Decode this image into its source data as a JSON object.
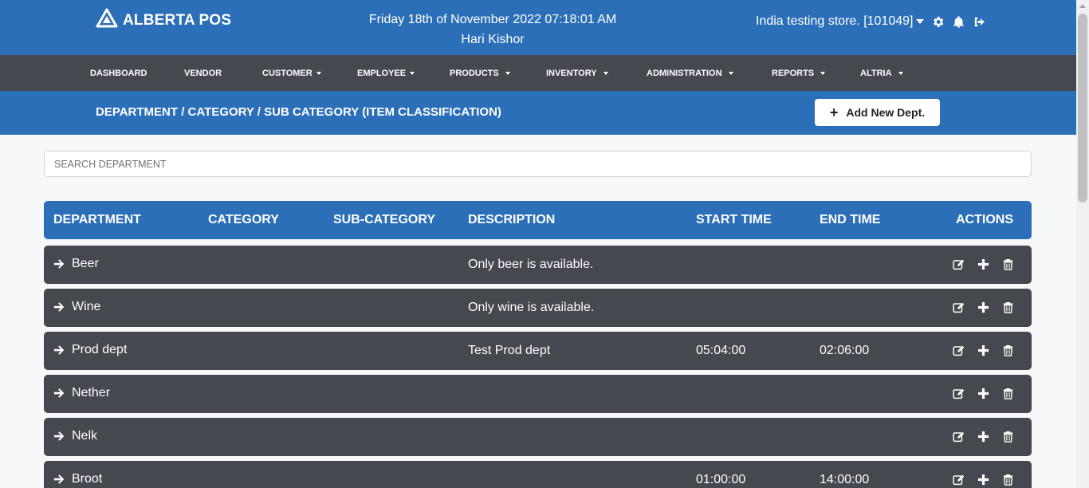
{
  "header": {
    "brand": "ALBERTA POS",
    "datetime": "Friday 18th of November 2022 07:18:01 AM",
    "user": "Hari Kishor",
    "store": "India testing store. [101049]",
    "icons": [
      "settings-gear-icon",
      "bell-icon",
      "logout-icon"
    ]
  },
  "nav": {
    "items": [
      {
        "label": "DASHBOARD"
      },
      {
        "label": "VENDOR"
      },
      {
        "label": "CUSTOMER"
      },
      {
        "label": "EMPLOYEE"
      },
      {
        "label": "PRODUCTS"
      },
      {
        "label": "INVENTORY"
      },
      {
        "label": "ADMINISTRATION"
      },
      {
        "label": "REPORTS"
      },
      {
        "label": "ALTRIA"
      }
    ]
  },
  "subheader": {
    "title": "DEPARTMENT / CATEGORY / SUB CATEGORY (ITEM CLASSIFICATION)",
    "add_button": "Add New Dept."
  },
  "search": {
    "placeholder": "SEARCH DEPARTMENT",
    "value": ""
  },
  "table": {
    "columns": [
      "DEPARTMENT",
      "CATEGORY",
      "SUB-CATEGORY",
      "DESCRIPTION",
      "START TIME",
      "END TIME",
      "ACTIONS"
    ],
    "rows": [
      {
        "department": "Beer",
        "category": "",
        "subcategory": "",
        "description": "Only beer is available.",
        "start_time": "",
        "end_time": ""
      },
      {
        "department": "Wine",
        "category": "",
        "subcategory": "",
        "description": "Only wine is available.",
        "start_time": "",
        "end_time": ""
      },
      {
        "department": "Prod dept",
        "category": "",
        "subcategory": "",
        "description": "Test Prod dept",
        "start_time": "05:04:00",
        "end_time": "02:06:00"
      },
      {
        "department": "Nether",
        "category": "",
        "subcategory": "",
        "description": "",
        "start_time": "",
        "end_time": ""
      },
      {
        "department": "Nelk",
        "category": "",
        "subcategory": "",
        "description": "",
        "start_time": "",
        "end_time": ""
      },
      {
        "department": "Broot",
        "category": "",
        "subcategory": "",
        "description": "",
        "start_time": "01:00:00",
        "end_time": "14:00:00"
      }
    ],
    "row_actions": [
      "edit-icon",
      "plus-icon",
      "trash-icon"
    ]
  },
  "colors": {
    "primary": "#2c6fb9",
    "nav_bg": "#45484e",
    "row_bg": "#45484e",
    "page_bg": "#f7f8fa"
  }
}
